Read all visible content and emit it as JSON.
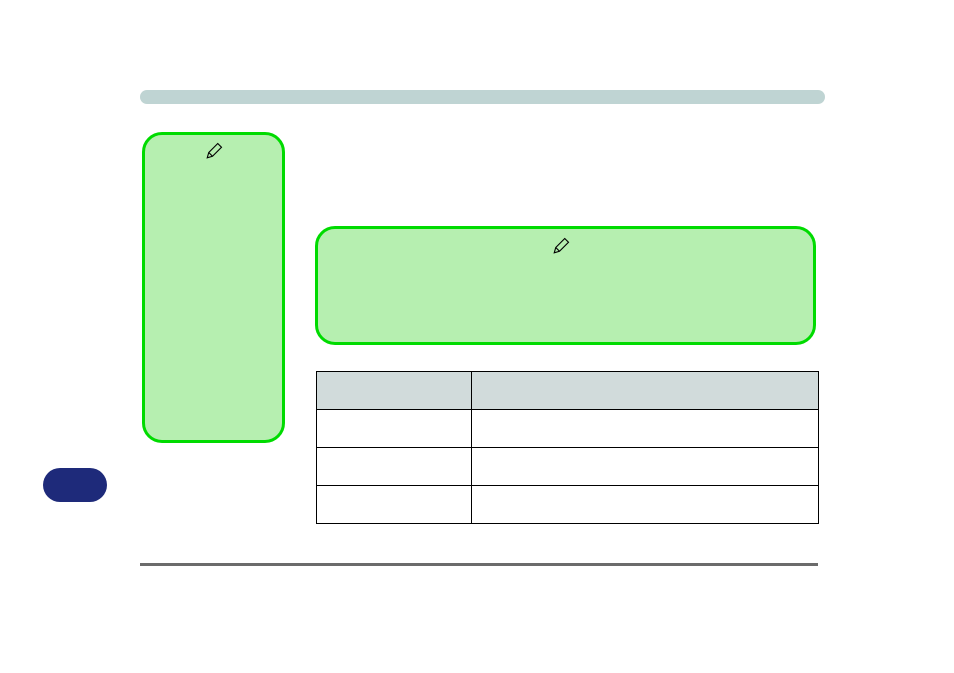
{
  "header": {
    "title": ""
  },
  "boxLeft": {
    "content": ""
  },
  "boxRight": {
    "content": ""
  },
  "table": {
    "headers": [
      "",
      ""
    ],
    "rows": [
      [
        "",
        ""
      ],
      [
        "",
        ""
      ],
      [
        "",
        ""
      ]
    ]
  },
  "badge": {
    "label": ""
  },
  "icons": {
    "pen1": "pen-icon",
    "pen2": "pen-icon"
  }
}
